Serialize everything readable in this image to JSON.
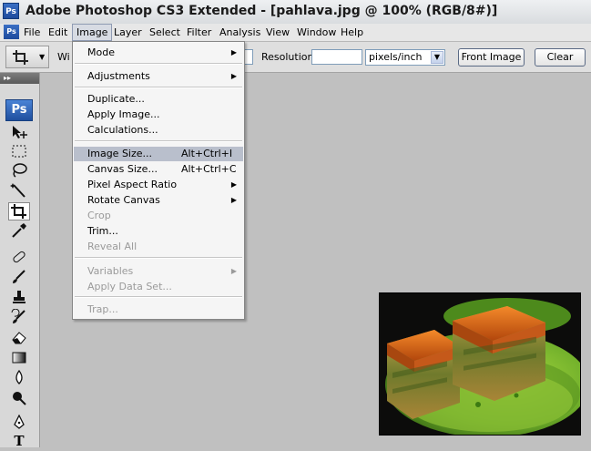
{
  "window": {
    "title": "Adobe Photoshop CS3 Extended - [pahlava.jpg @ 100% (RGB/8#)]",
    "app_icon": "Ps"
  },
  "menubar": {
    "items": [
      "File",
      "Edit",
      "Image",
      "Layer",
      "Select",
      "Filter",
      "Analysis",
      "View",
      "Window",
      "Help"
    ],
    "active": "Image"
  },
  "options": {
    "width_label_partial": "Wi",
    "resolution_label": "Resolution:",
    "resolution_value": "",
    "units_selected": "pixels/inch",
    "front_image_label": "Front Image",
    "clear_label": "Clear"
  },
  "toolbox": {
    "logo": "Ps",
    "tools": [
      "move-icon",
      "marquee-icon",
      "lasso-icon",
      "magic-wand-icon",
      "crop-icon",
      "eyedropper-icon",
      "healing-brush-icon",
      "brush-icon",
      "clone-stamp-icon",
      "history-brush-icon",
      "eraser-icon",
      "gradient-icon",
      "blur-icon",
      "dodge-icon",
      "pen-icon",
      "type-icon"
    ],
    "selected": "crop-icon"
  },
  "image_menu": {
    "items": [
      {
        "label": "Mode",
        "submenu": true
      },
      {
        "label": "Adjustments",
        "submenu": true
      },
      {
        "label": "Duplicate..."
      },
      {
        "label": "Apply Image..."
      },
      {
        "label": "Calculations..."
      },
      {
        "label": "Image Size...",
        "shortcut": "Alt+Ctrl+I",
        "highlighted": true
      },
      {
        "label": "Canvas Size...",
        "shortcut": "Alt+Ctrl+C"
      },
      {
        "label": "Pixel Aspect Ratio",
        "submenu": true
      },
      {
        "label": "Rotate Canvas",
        "submenu": true
      },
      {
        "label": "Crop",
        "disabled": true
      },
      {
        "label": "Trim..."
      },
      {
        "label": "Reveal All",
        "disabled": true
      },
      {
        "label": "Variables",
        "submenu": true,
        "disabled": true
      },
      {
        "label": "Apply Data Set...",
        "disabled": true
      },
      {
        "label": "Trap...",
        "disabled": true
      }
    ]
  },
  "colors": {
    "workspace": "#c0c0c0",
    "menu_highlight": "#b9bfcc",
    "plate_green": "#6fae2a",
    "pastry_orange": "#d9661a"
  }
}
